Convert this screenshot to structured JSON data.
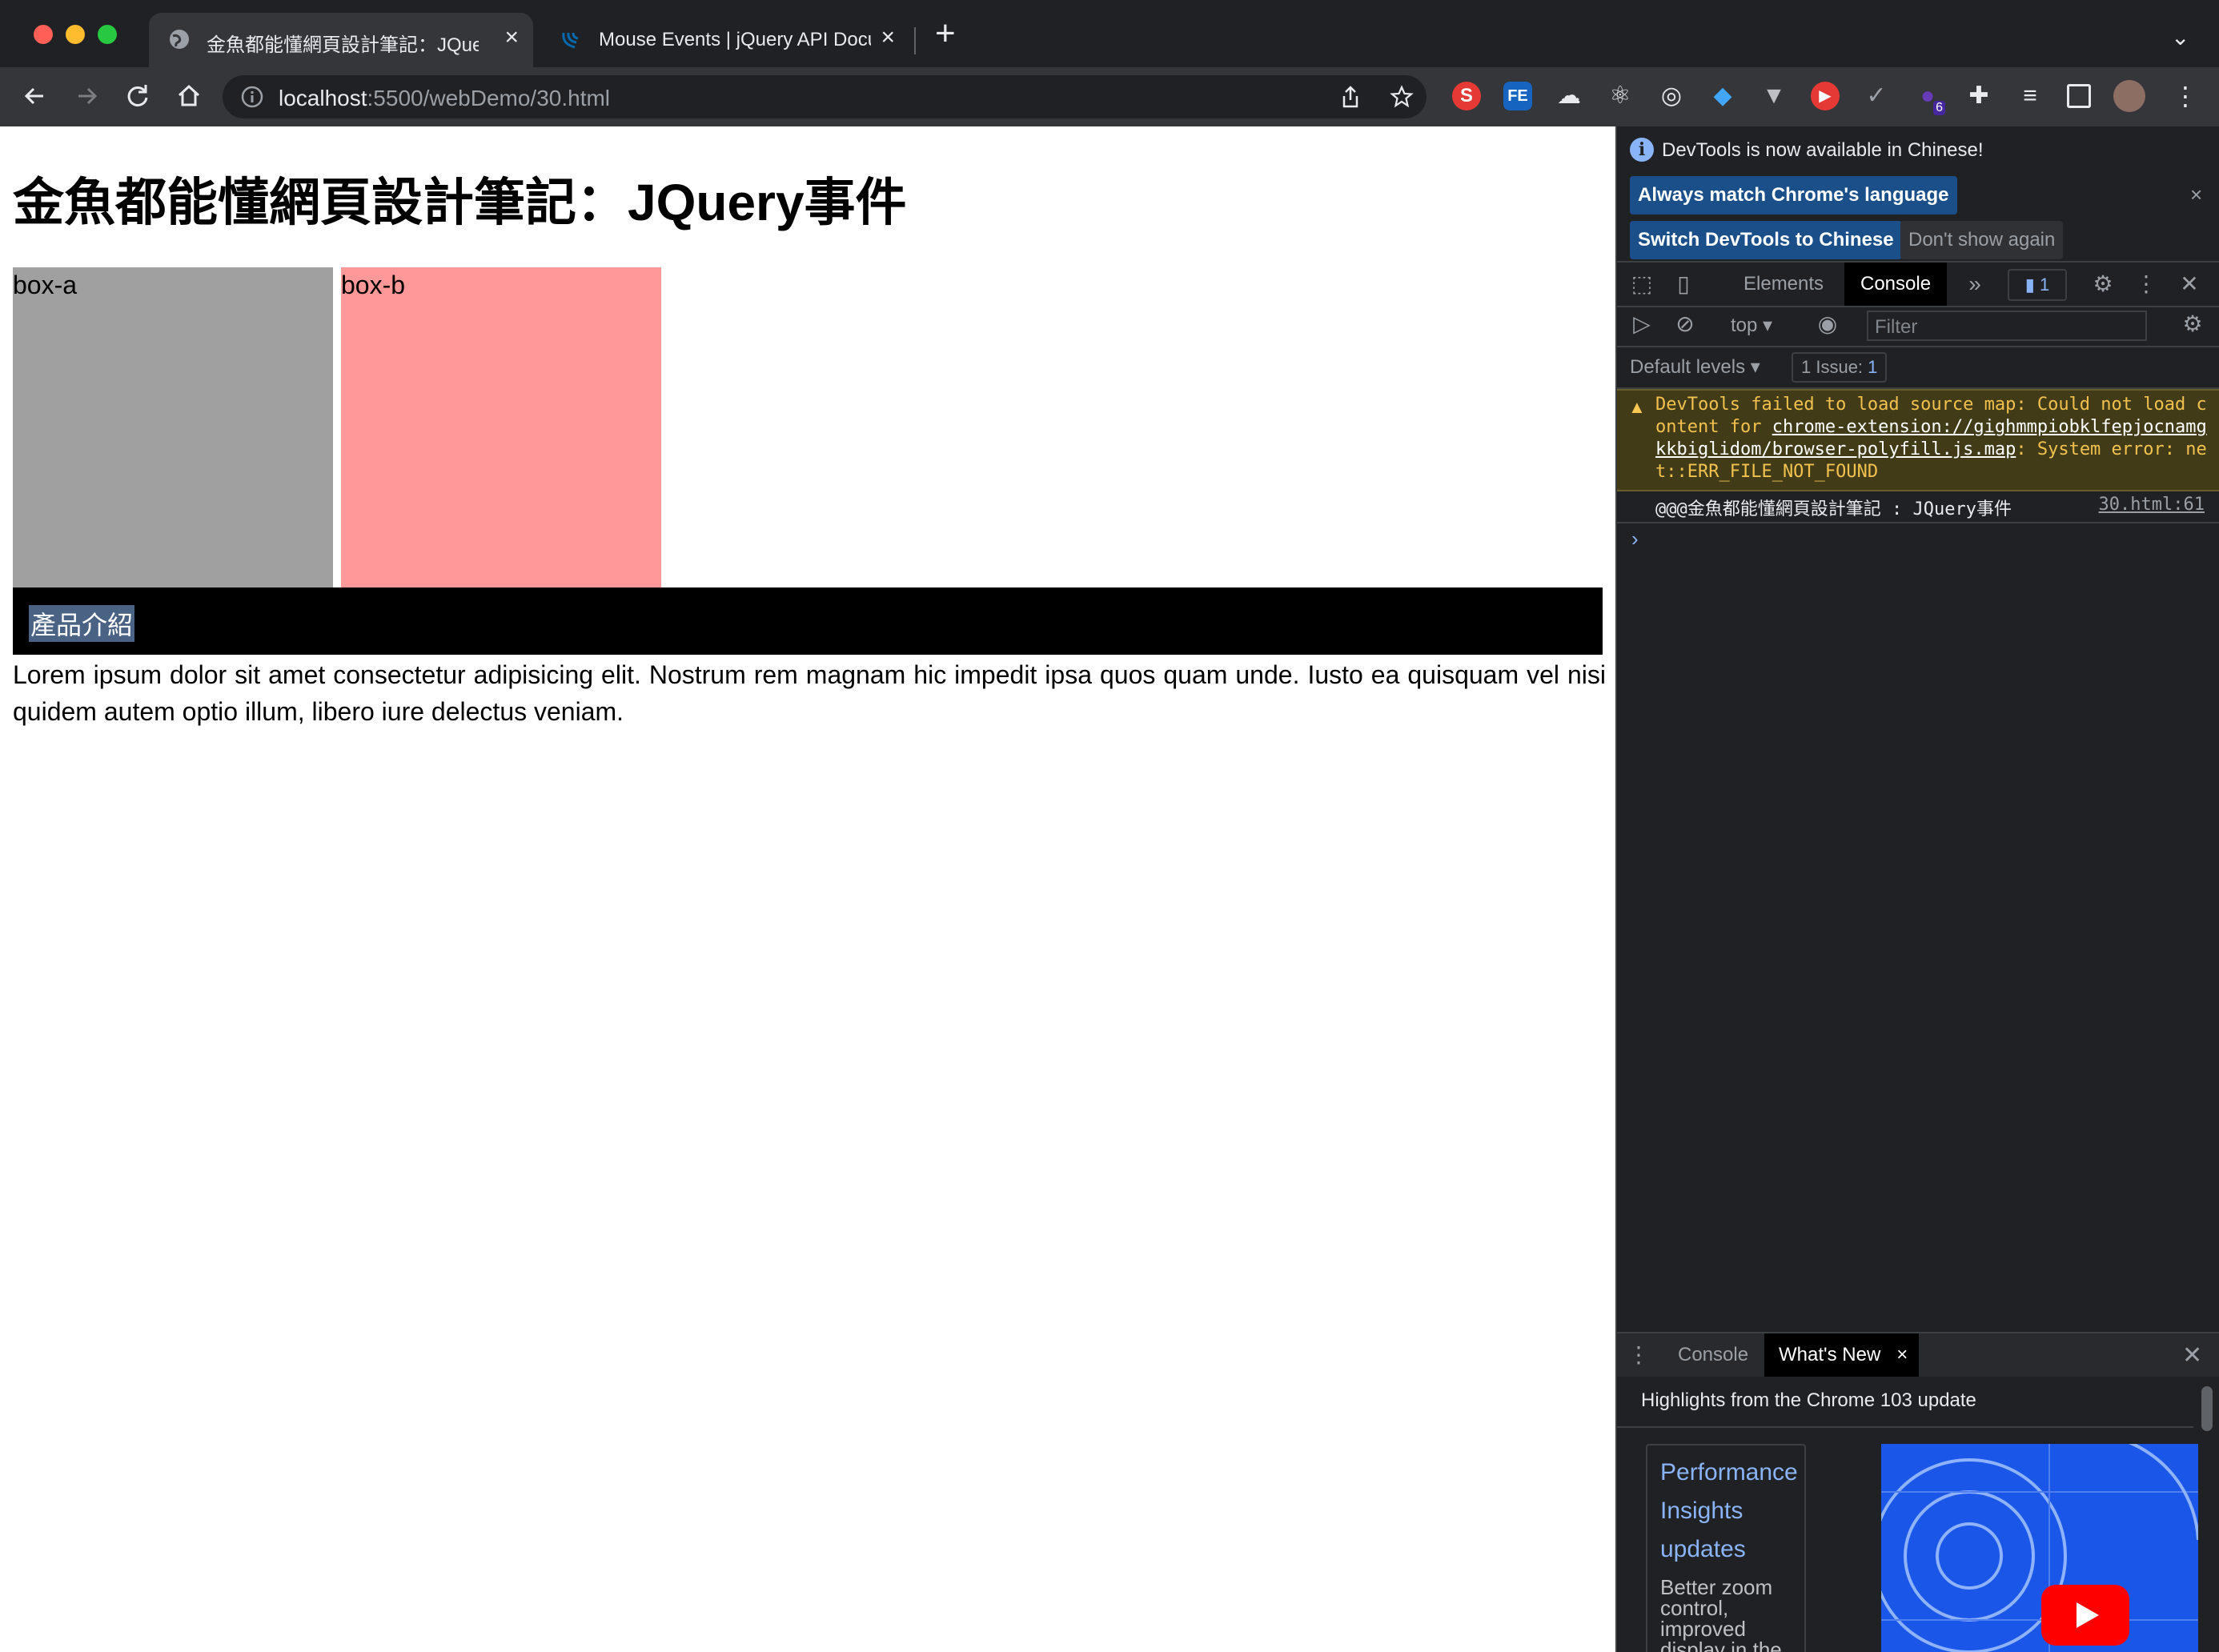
{
  "browser": {
    "tabs": [
      {
        "title": "金魚都能懂網頁設計筆記：JQuery事件",
        "active": true
      },
      {
        "title": "Mouse Events | jQuery API Documentation",
        "active": false
      }
    ],
    "url_host": "localhost",
    "url_path": ":5500/webDemo/30.html",
    "extension_badge": "6"
  },
  "page": {
    "heading": "金魚都能懂網頁設計筆記：JQuery事件",
    "box_a": "box-a",
    "box_b": "box-b",
    "product_title": "產品介紹",
    "paragraph": "Lorem ipsum dolor sit amet consectetur adipisicing elit. Nostrum rem magnam hic impedit ipsa quos quam unde. Iusto ea quisquam vel nisi quidem autem optio illum, libero iure delectus veniam."
  },
  "devtools": {
    "notice": "DevTools is now available in Chinese!",
    "btn_match": "Always match Chrome's language",
    "btn_switch": "Switch DevTools to Chinese",
    "btn_dont_show": "Don't show again",
    "tabs": [
      "Elements",
      "Console"
    ],
    "issue_badge": "1",
    "context": "top ▾",
    "filter_placeholder": "Filter",
    "levels": "Default levels ▾",
    "issues_label": "1 Issue:",
    "issues_count": "1",
    "warning_pre": "DevTools failed to load source map: Could not load content for ",
    "warning_link": "chrome-extension://gighmmpiobklfepjocnamgkkbiglidom/browser-polyfill.js.map",
    "warning_post": ": System error: net::ERR_FILE_NOT_FOUND",
    "log_text": "@@@金魚都能懂網頁設計筆記 : JQuery事件",
    "log_source": "30.html:61",
    "drawer_tabs": [
      "Console",
      "What's New"
    ],
    "whats_new_heading": "Highlights from the Chrome 103 update",
    "card_title": "Performance Insights updates",
    "card_desc": "Better zoom control, improved display in the Details pane"
  },
  "colors": {
    "box_a": "#a0a0a0",
    "box_b": "#ff9999",
    "product_bar": "#000000",
    "devtools_bg": "#202124",
    "warning_bg": "#413b18"
  }
}
